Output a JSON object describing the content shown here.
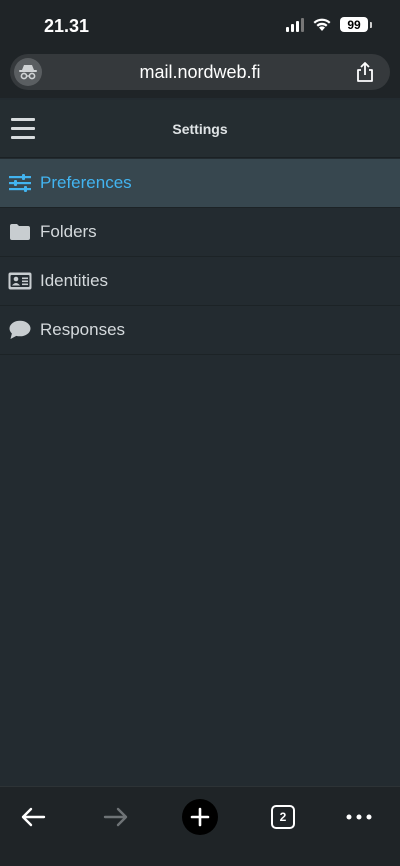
{
  "status_bar": {
    "time": "21.31",
    "battery": "99"
  },
  "browser": {
    "url": "mail.nordweb.fi",
    "tabs_count": "2"
  },
  "header": {
    "title": "Settings"
  },
  "settings": {
    "items": [
      {
        "label": "Preferences",
        "icon": "sliders-icon",
        "active": true
      },
      {
        "label": "Folders",
        "icon": "folder-icon",
        "active": false
      },
      {
        "label": "Identities",
        "icon": "id-card-icon",
        "active": false
      },
      {
        "label": "Responses",
        "icon": "speech-bubble-icon",
        "active": false
      }
    ]
  },
  "colors": {
    "background": "#232b30",
    "active_item_bg": "#37474f",
    "accent": "#42b4f0",
    "text": "#d4d9dc"
  }
}
